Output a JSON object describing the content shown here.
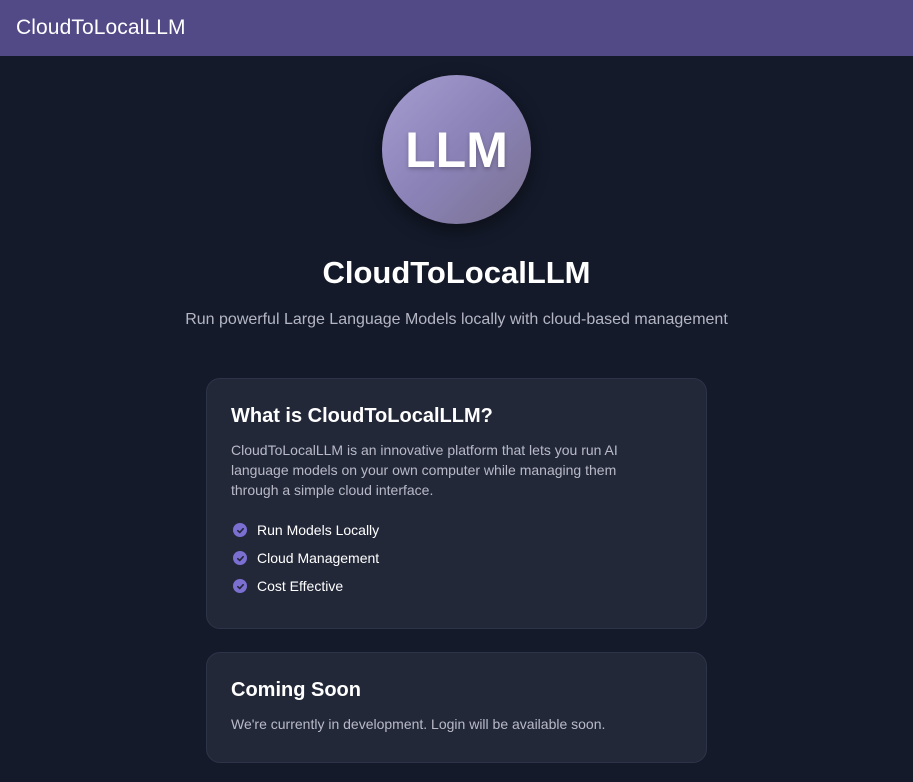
{
  "appbar": {
    "title": "CloudToLocalLLM"
  },
  "hero": {
    "logo_text": "LLM",
    "title": "CloudToLocalLLM",
    "subtitle": "Run powerful Large Language Models locally with cloud-based management"
  },
  "about_card": {
    "title": "What is CloudToLocalLLM?",
    "body": "CloudToLocalLLM is an innovative platform that lets you run AI language models on your own computer while managing them through a simple cloud interface.",
    "features": [
      {
        "label": "Run Models Locally",
        "icon": "check-circle-icon"
      },
      {
        "label": "Cloud Management",
        "icon": "check-circle-icon"
      },
      {
        "label": "Cost Effective",
        "icon": "check-circle-icon"
      }
    ]
  },
  "coming_soon_card": {
    "title": "Coming Soon",
    "body": "We're currently in development. Login will be available soon."
  },
  "colors": {
    "appbar": "#524a87",
    "background": "#141a2a",
    "card": "#232839",
    "accent": "#7b6fd1"
  }
}
